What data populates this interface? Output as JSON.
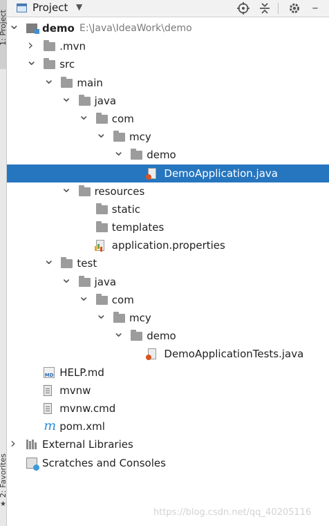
{
  "left_strip": {
    "top_label": "1: Project",
    "bottom_label": "2: Favorites"
  },
  "toolbar": {
    "title": "Project"
  },
  "tree": [
    {
      "depth": 0,
      "expand": "open",
      "icon": "module-icon",
      "label": "demo",
      "path": "E:\\Java\\IdeaWork\\demo",
      "bold": true
    },
    {
      "depth": 1,
      "expand": "closed",
      "icon": "folder-icon",
      "label": ".mvn"
    },
    {
      "depth": 1,
      "expand": "open",
      "icon": "folder-icon",
      "label": "src"
    },
    {
      "depth": 2,
      "expand": "open",
      "icon": "folder-icon",
      "label": "main"
    },
    {
      "depth": 3,
      "expand": "open",
      "icon": "folder-icon",
      "label": "java"
    },
    {
      "depth": 4,
      "expand": "open",
      "icon": "folder-icon",
      "label": "com"
    },
    {
      "depth": 5,
      "expand": "open",
      "icon": "folder-icon",
      "label": "mcy"
    },
    {
      "depth": 6,
      "expand": "open",
      "icon": "folder-icon",
      "label": "demo"
    },
    {
      "depth": 7,
      "expand": "none",
      "icon": "java-class-icon",
      "label": "DemoApplication.java",
      "selected": true
    },
    {
      "depth": 3,
      "expand": "open",
      "icon": "folder-icon",
      "label": "resources"
    },
    {
      "depth": 4,
      "expand": "none",
      "icon": "folder-icon",
      "label": "static"
    },
    {
      "depth": 4,
      "expand": "none",
      "icon": "folder-icon",
      "label": "templates"
    },
    {
      "depth": 4,
      "expand": "none",
      "icon": "properties-file-icon",
      "label": "application.properties"
    },
    {
      "depth": 2,
      "expand": "open",
      "icon": "folder-icon",
      "label": "test"
    },
    {
      "depth": 3,
      "expand": "open",
      "icon": "folder-icon",
      "label": "java"
    },
    {
      "depth": 4,
      "expand": "open",
      "icon": "folder-icon",
      "label": "com"
    },
    {
      "depth": 5,
      "expand": "open",
      "icon": "folder-icon",
      "label": "mcy"
    },
    {
      "depth": 6,
      "expand": "open",
      "icon": "folder-icon",
      "label": "demo"
    },
    {
      "depth": 7,
      "expand": "none",
      "icon": "java-class-icon",
      "label": "DemoApplicationTests.java"
    },
    {
      "depth": 1,
      "expand": "none",
      "icon": "markdown-file-icon",
      "label": "HELP.md"
    },
    {
      "depth": 1,
      "expand": "none",
      "icon": "text-file-icon",
      "label": "mvnw"
    },
    {
      "depth": 1,
      "expand": "none",
      "icon": "text-file-icon",
      "label": "mvnw.cmd"
    },
    {
      "depth": 1,
      "expand": "none",
      "icon": "maven-icon",
      "label": "pom.xml"
    },
    {
      "depth": 0,
      "expand": "closed",
      "icon": "libraries-icon",
      "label": "External Libraries"
    },
    {
      "depth": 0,
      "expand": "none",
      "icon": "scratches-icon",
      "label": "Scratches and Consoles"
    }
  ],
  "watermark": "https://blog.csdn.net/qq_40205116",
  "colors": {
    "selection": "#2675bf",
    "toolbar_bg": "#f2f2f2",
    "text": "#1f1f1f",
    "path_text": "#7a7a7a"
  }
}
